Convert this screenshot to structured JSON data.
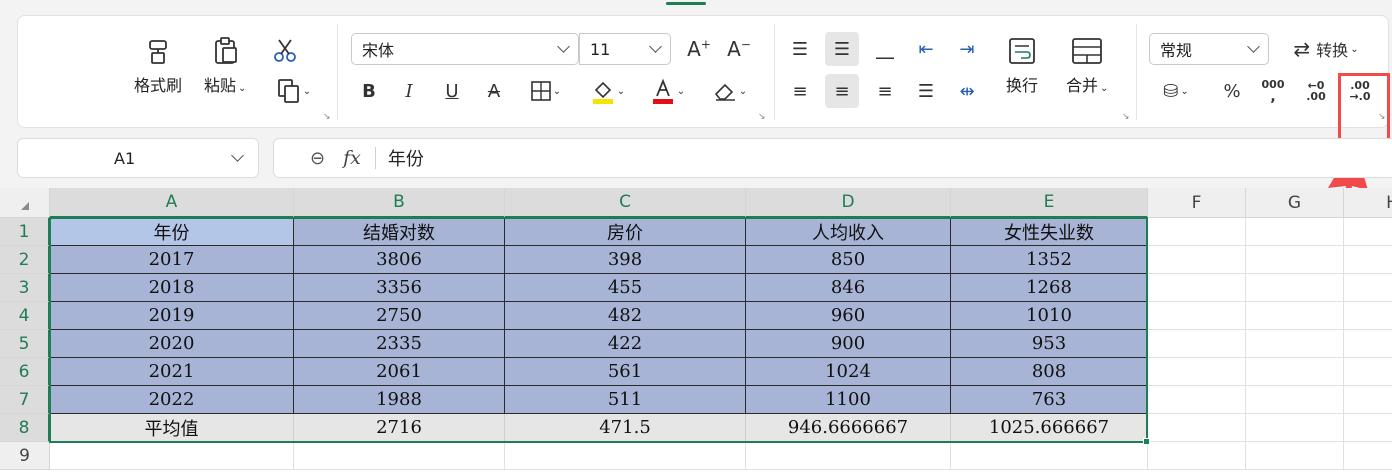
{
  "ribbon": {
    "format_painter": "格式刷",
    "paste": "粘贴",
    "font_name": "宋体",
    "font_size": "11",
    "wrap_text": "换行",
    "merge": "合并",
    "number_format": "常规",
    "convert": "转换",
    "percent_symbol": "%",
    "thousands_symbol": "000",
    "decrease_decimal_top": "←0",
    "decrease_decimal_bottom": ".00",
    "increase_decimal_top": ".00",
    "increase_decimal_bottom": "→.0",
    "font_grow": "A",
    "font_shrink": "A"
  },
  "formula": {
    "name_box": "A1",
    "fx": "fx",
    "content": "年份"
  },
  "grid": {
    "columns": [
      "A",
      "B",
      "C",
      "D",
      "E",
      "F",
      "G",
      "H"
    ],
    "rows": [
      "1",
      "2",
      "3",
      "4",
      "5",
      "6",
      "7",
      "8",
      "9"
    ],
    "header": [
      "年份",
      "结婚对数",
      "房价",
      "人均收入",
      "女性失业数"
    ],
    "data": [
      [
        "2017",
        "3806",
        "398",
        "850",
        "1352"
      ],
      [
        "2018",
        "3356",
        "455",
        "846",
        "1268"
      ],
      [
        "2019",
        "2750",
        "482",
        "960",
        "1010"
      ],
      [
        "2020",
        "2335",
        "422",
        "900",
        "953"
      ],
      [
        "2021",
        "2061",
        "561",
        "1024",
        "808"
      ],
      [
        "2022",
        "1988",
        "511",
        "1100",
        "763"
      ]
    ],
    "average": [
      "平均值",
      "2716",
      "471.5",
      "946.6666667",
      "1025.666667"
    ]
  },
  "colors": {
    "accent": "#1f7d53",
    "selected_fill": "#a8b4d6",
    "header_cell_fill": "#b4c6e7",
    "highlight": "#f04a4a"
  }
}
